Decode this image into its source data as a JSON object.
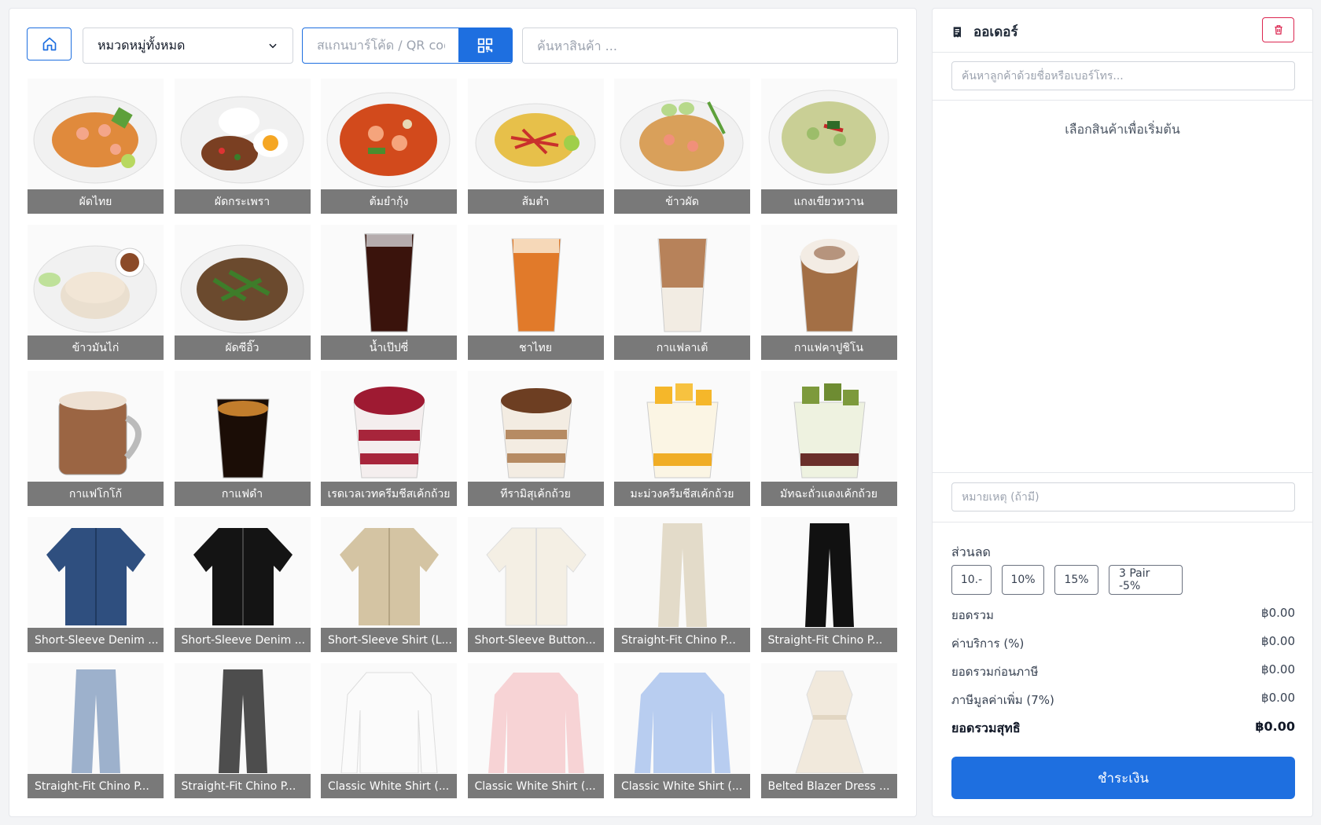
{
  "colors": {
    "primary": "#1e6fe0",
    "danger": "#dc2650",
    "label_overlay": "#6e6e6e"
  },
  "toolbar": {
    "category_value": "หมวดหมู่ทั้งหมด",
    "scan_placeholder": "สแกนบาร์โค้ด / QR code",
    "search_placeholder": "ค้นหาสินค้า ..."
  },
  "products": [
    {
      "name": "ผัดไทย",
      "icon": "pad-thai-plate"
    },
    {
      "name": "ผัดกระเพรา",
      "icon": "basil-stirfry-plate"
    },
    {
      "name": "ต้มยำกุ้ง",
      "icon": "tom-yum-bowl"
    },
    {
      "name": "ส้มตำ",
      "icon": "papaya-salad-plate"
    },
    {
      "name": "ข้าวผัด",
      "icon": "fried-rice-plate"
    },
    {
      "name": "แกงเขียวหวาน",
      "icon": "green-curry-bowl"
    },
    {
      "name": "ข้าวมันไก่",
      "icon": "chicken-rice-plate"
    },
    {
      "name": "ผัดซีอิ๊ว",
      "icon": "pad-see-ew-plate"
    },
    {
      "name": "น้ำเป๊ปซี่",
      "icon": "cola-glass"
    },
    {
      "name": "ชาไทย",
      "icon": "thai-tea-glass"
    },
    {
      "name": "กาแฟลาเต้",
      "icon": "latte-glass"
    },
    {
      "name": "กาแฟคาปูชิโน",
      "icon": "cappuccino-glass"
    },
    {
      "name": "กาแฟโกโก้",
      "icon": "cocoa-mug"
    },
    {
      "name": "กาแฟดำ",
      "icon": "black-coffee-glass"
    },
    {
      "name": "เรดเวลเวทครีมชีสเค้กถ้วย",
      "icon": "red-velvet-cup"
    },
    {
      "name": "ทีรามิสุเค้กถ้วย",
      "icon": "tiramisu-cup"
    },
    {
      "name": "มะม่วงครีมชีสเค้กถ้วย",
      "icon": "mango-cheesecake-cup"
    },
    {
      "name": "มัทฉะถั่วแดงเค้กถ้วย",
      "icon": "matcha-redbean-cup"
    },
    {
      "name": "Short-Sleeve Denim ...",
      "icon": "denim-shirt"
    },
    {
      "name": "Short-Sleeve Denim ...",
      "icon": "black-shirt"
    },
    {
      "name": "Short-Sleeve Shirt (L...",
      "icon": "beige-shirt"
    },
    {
      "name": "Short-Sleeve Button...",
      "icon": "cream-shirt"
    },
    {
      "name": "Straight-Fit Chino P...",
      "icon": "beige-chino-pants"
    },
    {
      "name": "Straight-Fit Chino P...",
      "icon": "black-chino-pants"
    },
    {
      "name": "Straight-Fit Chino P...",
      "icon": "light-blue-chino-pants"
    },
    {
      "name": "Straight-Fit Chino P...",
      "icon": "gray-chino-pants"
    },
    {
      "name": "Classic White Shirt (...",
      "icon": "white-long-shirt"
    },
    {
      "name": "Classic White Shirt (...",
      "icon": "pink-long-shirt"
    },
    {
      "name": "Classic White Shirt (...",
      "icon": "blue-long-shirt"
    },
    {
      "name": "Belted Blazer Dress ...",
      "icon": "cream-dress"
    }
  ],
  "order": {
    "title": "ออเดอร์",
    "customer_placeholder": "ค้นหาลูกค้าด้วยชื่อหรือเบอร์โทร...",
    "empty_message": "เลือกสินค้าเพื่อเริ่มต้น",
    "note_placeholder": "หมายเหตุ (ถ้ามี)",
    "discount_title": "ส่วนลด",
    "discounts": [
      "10.-",
      "10%",
      "15%",
      "3 Pair -5%"
    ],
    "summary": {
      "subtotal_label": "ยอดรวม",
      "subtotal_value": "฿0.00",
      "service_label": "ค่าบริการ (%)",
      "service_value": "฿0.00",
      "pretax_label": "ยอดรวมก่อนภาษี",
      "pretax_value": "฿0.00",
      "vat_label": "ภาษีมูลค่าเพิ่ม (7%)",
      "vat_value": "฿0.00",
      "total_label": "ยอดรวมสุทธิ",
      "total_value": "฿0.00"
    },
    "pay_label": "ชำระเงิน"
  }
}
